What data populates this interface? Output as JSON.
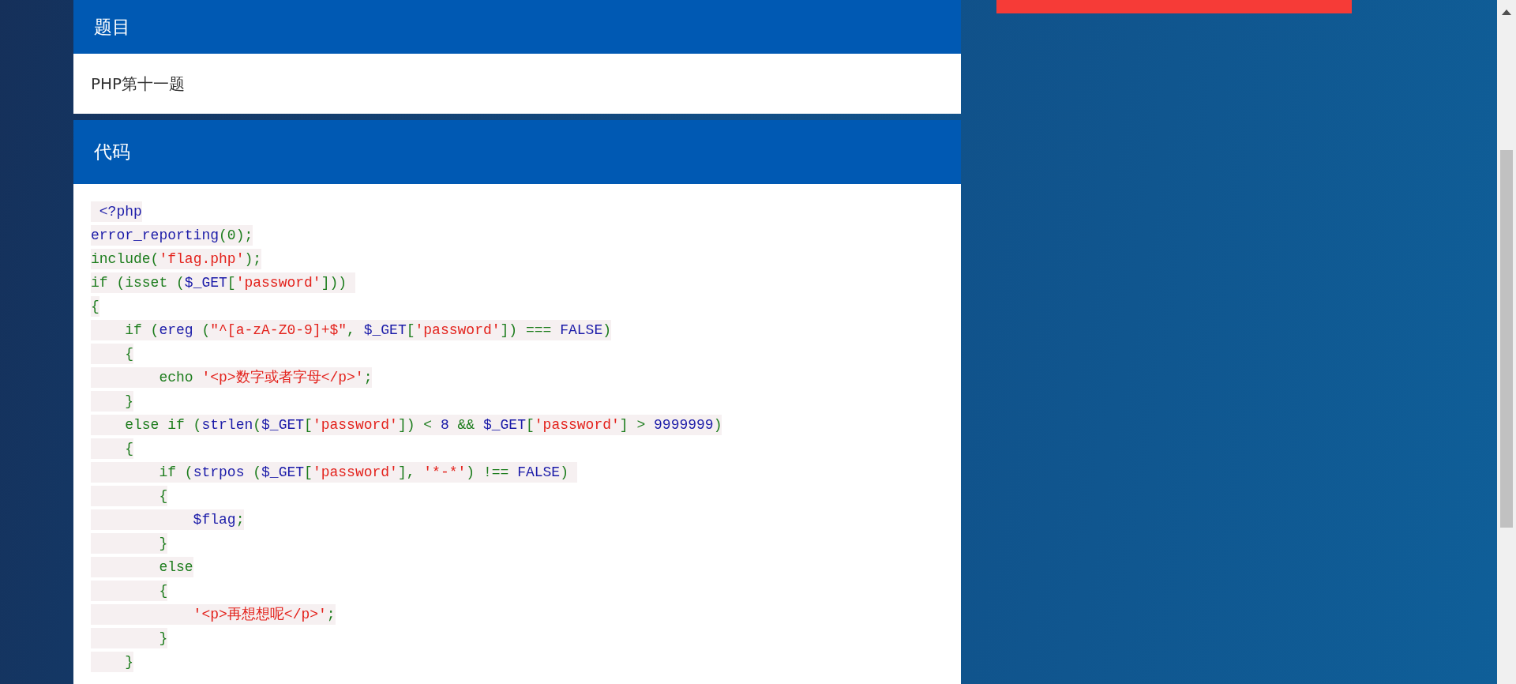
{
  "sections": [
    {
      "title": "题目",
      "body": "PHP第十一题"
    },
    {
      "title": "代码",
      "code": [
        [
          {
            "text": " <?php",
            "kind": "fn"
          }
        ],
        [
          {
            "text": "error_reporting",
            "kind": "fn"
          },
          {
            "text": "(0);",
            "kind": "kw"
          }
        ],
        [
          {
            "text": "include(",
            "kind": "kw"
          },
          {
            "text": "'flag.php'",
            "kind": "str"
          },
          {
            "text": ");",
            "kind": "kw"
          }
        ],
        [
          {
            "text": "if (isset (",
            "kind": "kw"
          },
          {
            "text": "$_GET",
            "kind": "fn"
          },
          {
            "text": "[",
            "kind": "kw"
          },
          {
            "text": "'password'",
            "kind": "str"
          },
          {
            "text": "])) ",
            "kind": "kw"
          }
        ],
        [
          {
            "text": "{",
            "kind": "kw"
          }
        ],
        [
          {
            "text": "    if (",
            "kind": "kw"
          },
          {
            "text": "ereg",
            "kind": "fn"
          },
          {
            "text": " (",
            "kind": "kw"
          },
          {
            "text": "\"^[a-zA-Z0-9]+$\"",
            "kind": "str"
          },
          {
            "text": ", ",
            "kind": "kw"
          },
          {
            "text": "$_GET",
            "kind": "fn"
          },
          {
            "text": "[",
            "kind": "kw"
          },
          {
            "text": "'password'",
            "kind": "str"
          },
          {
            "text": "]) === ",
            "kind": "kw"
          },
          {
            "text": "FALSE",
            "kind": "fn"
          },
          {
            "text": ")",
            "kind": "kw"
          }
        ],
        [
          {
            "text": "    {",
            "kind": "kw"
          }
        ],
        [
          {
            "text": "        echo ",
            "kind": "kw"
          },
          {
            "text": "'<p>数字或者字母</p>'",
            "kind": "str"
          },
          {
            "text": ";",
            "kind": "kw"
          }
        ],
        [
          {
            "text": "    }",
            "kind": "kw"
          }
        ],
        [
          {
            "text": "    else if (",
            "kind": "kw"
          },
          {
            "text": "strlen",
            "kind": "fn"
          },
          {
            "text": "(",
            "kind": "kw"
          },
          {
            "text": "$_GET",
            "kind": "fn"
          },
          {
            "text": "[",
            "kind": "kw"
          },
          {
            "text": "'password'",
            "kind": "str"
          },
          {
            "text": "]) < ",
            "kind": "kw"
          },
          {
            "text": "8",
            "kind": "fn"
          },
          {
            "text": " && ",
            "kind": "kw"
          },
          {
            "text": "$_GET",
            "kind": "fn"
          },
          {
            "text": "[",
            "kind": "kw"
          },
          {
            "text": "'password'",
            "kind": "str"
          },
          {
            "text": "] > ",
            "kind": "kw"
          },
          {
            "text": "9999999",
            "kind": "fn"
          },
          {
            "text": ")",
            "kind": "kw"
          }
        ],
        [
          {
            "text": "    {",
            "kind": "kw"
          }
        ],
        [
          {
            "text": "        if (",
            "kind": "kw"
          },
          {
            "text": "strpos",
            "kind": "fn"
          },
          {
            "text": " (",
            "kind": "kw"
          },
          {
            "text": "$_GET",
            "kind": "fn"
          },
          {
            "text": "[",
            "kind": "kw"
          },
          {
            "text": "'password'",
            "kind": "str"
          },
          {
            "text": "], ",
            "kind": "kw"
          },
          {
            "text": "'*-*'",
            "kind": "str"
          },
          {
            "text": ") !== ",
            "kind": "kw"
          },
          {
            "text": "FALSE",
            "kind": "fn"
          },
          {
            "text": ") ",
            "kind": "kw"
          }
        ],
        [
          {
            "text": "        {",
            "kind": "kw"
          }
        ],
        [
          {
            "text": "            $flag",
            "kind": "fn"
          },
          {
            "text": ";",
            "kind": "kw"
          }
        ],
        [
          {
            "text": "        }",
            "kind": "kw"
          }
        ],
        [
          {
            "text": "        else",
            "kind": "kw"
          }
        ],
        [
          {
            "text": "        {",
            "kind": "kw"
          }
        ],
        [
          {
            "text": "            '<p>再想想呢</p>'",
            "kind": "str"
          },
          {
            "text": ";",
            "kind": "kw"
          }
        ],
        [
          {
            "text": "        }",
            "kind": "kw"
          }
        ],
        [
          {
            "text": "    }",
            "kind": "kw"
          }
        ]
      ]
    }
  ]
}
